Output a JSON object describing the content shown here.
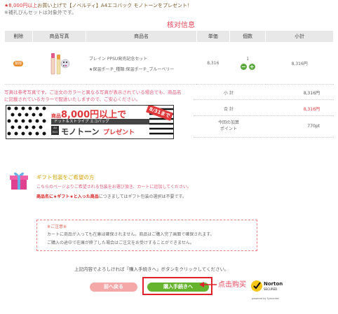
{
  "top_note": {
    "line1_prefix": "★8,000円以上",
    "line1_suffix": "お買い上げで【ノベルティ】A4エコバック モノトーンをプレゼント！",
    "line2": "※補礼びんセットは対象外です。"
  },
  "annotation_title": "核对信息",
  "table": {
    "headers": [
      "削除",
      "商品写真",
      "商品名",
      "単価",
      "個数",
      "小計"
    ],
    "row": {
      "delete_label": "削除",
      "name_line1": "ブレイン PPSU発売記念セット",
      "name_line2": "★保温ポーチ_種類:保温ポーチ_ブルーベリー",
      "price": "8,316",
      "qty": "1",
      "subtotal": "8,316円"
    }
  },
  "pink_note": "写真は参考写真です。ご注文のカラーと異なる写真が表示されている場合でも、商品名に記載されているカラーで配送いたしますので、ご安心ください。",
  "summary": {
    "subtotal_label": "小 計",
    "subtotal_value": "8,316円",
    "total_label": "合 計",
    "total_value": "8,316円",
    "points_label1": "今回の加算",
    "points_label2": "ポイント",
    "points_value": "770pt"
  },
  "banner": {
    "line1_prefix": "商品",
    "line1_amount": "8,000円以上で",
    "line2": "ドット＆ストライプ エコバッグ",
    "line3_logo": "A4 ECO",
    "line3_title": "モノトーン",
    "line3_suffix": "プレゼント",
    "date_tag": "8/31まで"
  },
  "gift": {
    "title": "ギフト包装をご希望の方",
    "line1": "こちらのページよりご希望される包装をお選び頂き、カートに追加してください。",
    "line2_bold": "商品名に★ギフト★と入った商品",
    "line2_rest": "につきましてはギフト包装の選択は不要です。"
  },
  "notice": {
    "title": "※ご注意※",
    "line1": "カートに商品が入っても在庫は確保されません。商品はご購入完了画面で確保されます。",
    "line2": "ご購入の途中で在庫が終了した場合はご注文をお受けすることができません。"
  },
  "instruction": "上記内容でよろしければ「購入手続きへ」ボタンをクリックしてください。",
  "buttons": {
    "back": "前へ戻る",
    "next": "購入手続きへ"
  },
  "click_annotation": "点击购买",
  "norton": {
    "brand": "Norton",
    "secured": "SECURED",
    "powered": "powered by Symantec"
  },
  "colors": {
    "accent_red": "#e0383a",
    "annotation_pink": "#e8455a",
    "green_button": "#66b32e",
    "back_button": "#f4a8a8"
  }
}
